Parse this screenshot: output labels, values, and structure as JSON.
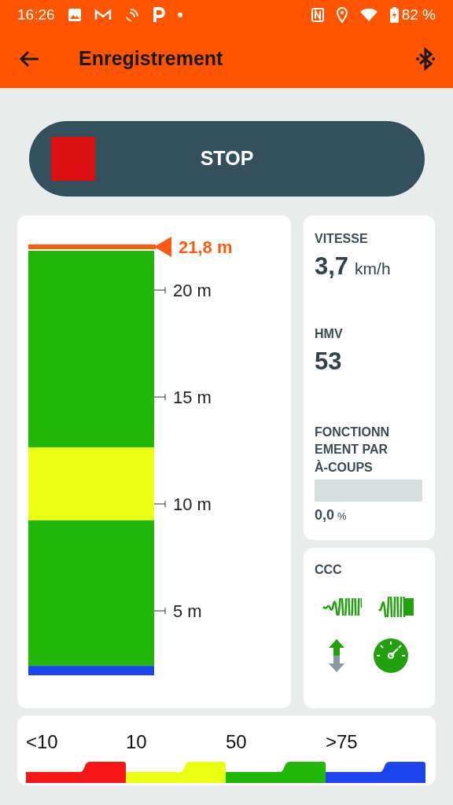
{
  "status_bar": {
    "time": "16:26",
    "battery": "82 %"
  },
  "app_bar": {
    "title": "Enregistrement"
  },
  "stop_button": {
    "label": "STOP"
  },
  "depth_column": {
    "max_depth": "21,8 m",
    "ticks": [
      "20 m",
      "15 m",
      "10 m",
      "5 m"
    ],
    "layers": [
      {
        "color": "#22b80a"
      },
      {
        "color": "#eaff12"
      },
      {
        "color": "#22b80a"
      },
      {
        "color": "#1e44f0"
      }
    ]
  },
  "speed": {
    "label": "VITESSE",
    "value": "3,7",
    "unit": "km/h"
  },
  "hmv": {
    "label": "HMV",
    "value": "53"
  },
  "jerk": {
    "label": "FONCTIONNEMENT PAR À-COUPS",
    "level": 0,
    "value": "0,0",
    "unit": "%"
  },
  "ccc": {
    "title": "CCC"
  },
  "legend": [
    {
      "label": "<10",
      "color": "#f51616"
    },
    {
      "label": "10",
      "color": "#eaff12"
    },
    {
      "label": "50",
      "color": "#22b80a"
    },
    {
      "label": ">75",
      "color": "#1e44f0"
    }
  ]
}
